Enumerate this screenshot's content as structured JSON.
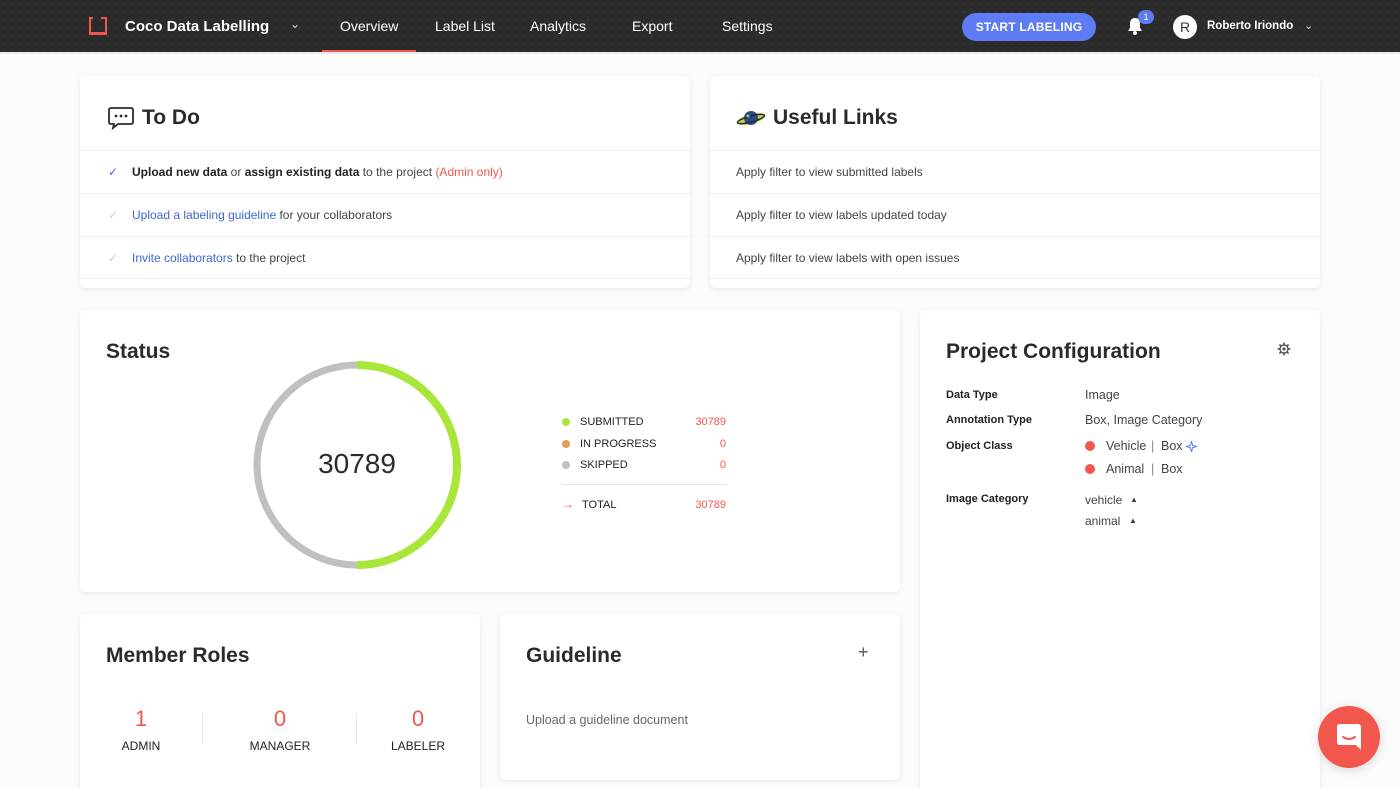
{
  "header": {
    "brand": "Coco Data Labelling",
    "nav": [
      "Overview",
      "Label List",
      "Analytics",
      "Export",
      "Settings"
    ],
    "active_nav": "Overview",
    "start_button": "START LABELING",
    "notification_count": "1",
    "avatar_initial": "R",
    "user_name": "Roberto Iriondo"
  },
  "todo": {
    "title": "To Do",
    "items": [
      {
        "parts": [
          {
            "text": "Upload new data",
            "style": "strong"
          },
          {
            "text": " or ",
            "style": "plain"
          },
          {
            "text": "assign existing data",
            "style": "strong"
          },
          {
            "text": " to the project ",
            "style": "plain"
          },
          {
            "text": "(Admin only)",
            "style": "admin"
          }
        ],
        "done": true
      },
      {
        "parts": [
          {
            "text": "Upload a labeling guideline",
            "style": "link"
          },
          {
            "text": " for your collaborators",
            "style": "plain"
          }
        ],
        "done": false
      },
      {
        "parts": [
          {
            "text": "Invite collaborators",
            "style": "link"
          },
          {
            "text": " to the project",
            "style": "plain"
          }
        ],
        "done": false
      }
    ]
  },
  "links": {
    "title": "Useful Links",
    "items": [
      "Apply filter to view submitted labels",
      "Apply filter to view labels updated today",
      "Apply filter to view labels with open issues"
    ]
  },
  "status": {
    "title": "Status",
    "center_value": "30789",
    "submitted_fraction": 0.5,
    "legend": [
      {
        "label": "SUBMITTED",
        "value": "30789",
        "color": "#a8e63a"
      },
      {
        "label": "IN PROGRESS",
        "value": "0",
        "color": "#e0a050"
      },
      {
        "label": "SKIPPED",
        "value": "0",
        "color": "#c0c0c0"
      }
    ],
    "total_label": "TOTAL",
    "total_value": "30789"
  },
  "config": {
    "title": "Project Configuration",
    "data_type_label": "Data Type",
    "data_type": "Image",
    "annotation_type_label": "Annotation Type",
    "annotation_type": "Box, Image Category",
    "object_class_label": "Object Class",
    "object_classes": [
      {
        "name": "Vehicle",
        "type": "Box",
        "color": "#f1574d"
      },
      {
        "name": "Animal",
        "type": "Box",
        "color": "#f1574d"
      }
    ],
    "separator": "|",
    "image_category_label": "Image Category",
    "image_categories": [
      "vehicle",
      "animal"
    ]
  },
  "roles": {
    "title": "Member Roles",
    "items": [
      {
        "count": "1",
        "label": "ADMIN"
      },
      {
        "count": "0",
        "label": "MANAGER"
      },
      {
        "count": "0",
        "label": "LABELER"
      }
    ]
  },
  "guideline": {
    "title": "Guideline",
    "add_symbol": "+",
    "text": "Upload a guideline document"
  },
  "colors": {
    "accent": "#f1574d",
    "primary": "#5d7bf2",
    "submitted": "#a8e63a",
    "skipped": "#c0c0c0"
  }
}
